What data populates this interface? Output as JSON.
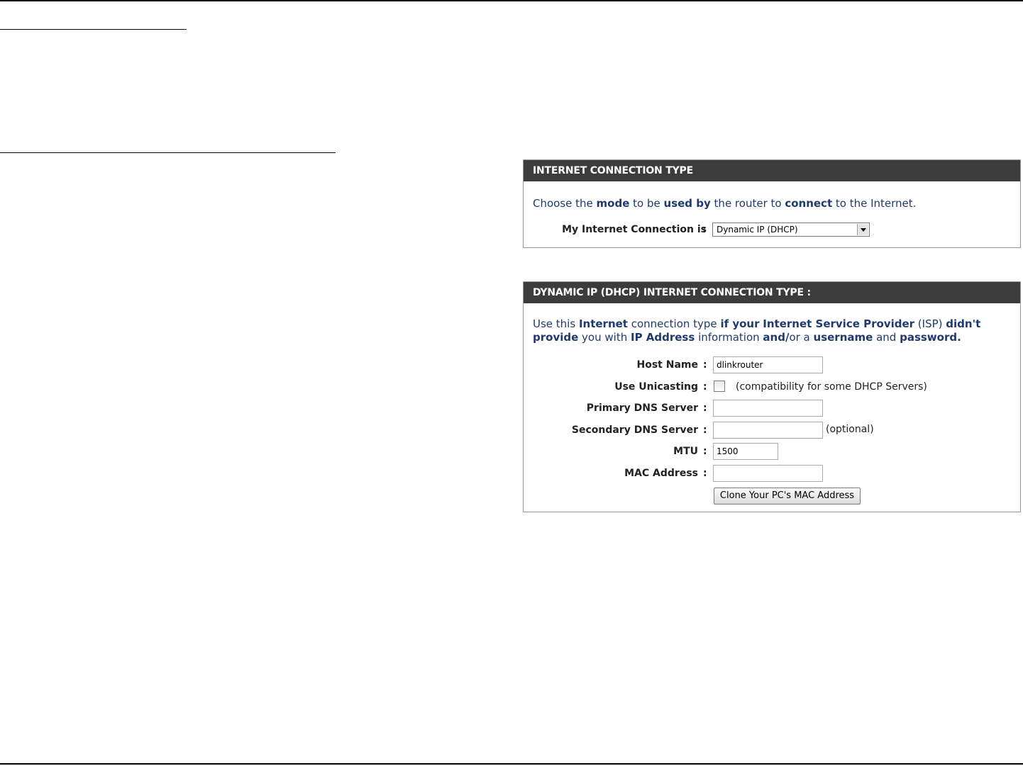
{
  "panel1": {
    "header": "INTERNET CONNECTION TYPE",
    "description_parts": [
      "Choose the ",
      "mode",
      " to be ",
      "used by",
      " the router to ",
      "connect",
      " to the Internet."
    ],
    "connection_label": "My Internet Connection is",
    "colon": ":",
    "connection_value": "Dynamic IP (DHCP)"
  },
  "panel2": {
    "header": "DYNAMIC IP (DHCP) INTERNET CONNECTION TYPE :",
    "description_parts": [
      "Use this ",
      "Internet",
      " connection type ",
      "if your",
      " ",
      "Internet Service Provider",
      " (ISP) ",
      "didn't provide",
      " you with ",
      "IP Address",
      " information ",
      "and/",
      "or a ",
      "username",
      " and ",
      "password."
    ],
    "colon": ":",
    "host_name_label": "Host Name",
    "host_name_value": "dlinkrouter",
    "unicasting_label": "Use Unicasting",
    "unicasting_checked": false,
    "unicasting_hint": "(compatibility for some DHCP Servers)",
    "primary_dns_label": "Primary DNS Server",
    "primary_dns_value": "",
    "secondary_dns_label": "Secondary DNS Server",
    "secondary_dns_value": "",
    "secondary_dns_hint": "(optional)",
    "mtu_label": "MTU",
    "mtu_value": "1500",
    "mac_label": "MAC Address",
    "mac_value": "",
    "clone_button": "Clone Your PC's MAC Address"
  }
}
